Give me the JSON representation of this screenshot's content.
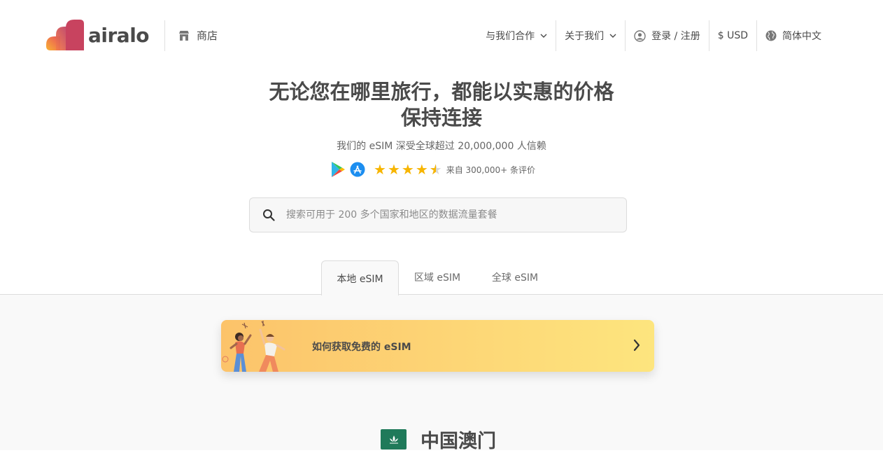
{
  "header": {
    "logo_text": "airalo",
    "shop_label": "商店",
    "nav": {
      "partner": "与我们合作",
      "about": "关于我们",
      "login": "登录 / 注册",
      "currency": "$ USD",
      "language": "简体中文"
    }
  },
  "hero": {
    "title_line1": "无论您在哪里旅行，都能以实惠的价格",
    "title_line2": "保持连接",
    "subtitle": "我们的 eSIM 深受全球超过 20,000,000 人信赖",
    "rating_value": 4.5,
    "reviews_text": "来自 300,000+ 条评价"
  },
  "search": {
    "placeholder": "搜索可用于 200 多个国家和地区的数据流量套餐"
  },
  "tabs": [
    {
      "label": "本地 eSIM"
    },
    {
      "label": "区域 eSIM"
    },
    {
      "label": "全球 eSIM"
    }
  ],
  "banner": {
    "text": "如何获取免费的 eSIM"
  },
  "country": {
    "name": "中国澳门"
  },
  "colors": {
    "accent_star": "#f7b500",
    "banner_start": "#fcc36a",
    "banner_end": "#fde57e",
    "flag_green": "#1f7a5a"
  }
}
